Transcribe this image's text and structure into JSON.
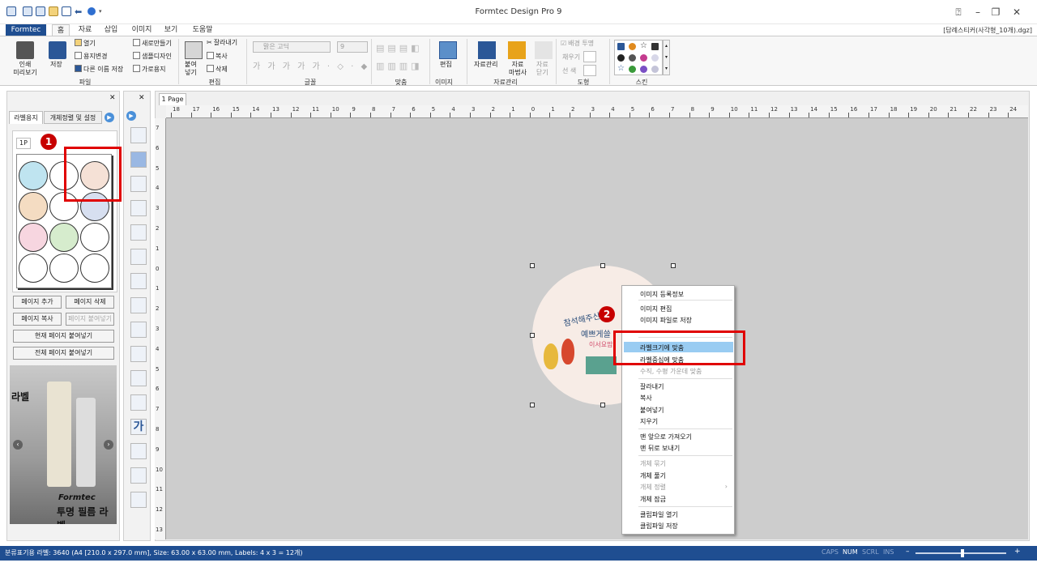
{
  "app": {
    "title": "Formtec Design Pro 9",
    "doc_name": "[답례스티커(사각형_10개).dgz]"
  },
  "menu": {
    "formtec": "Formtec",
    "tabs": [
      "홈",
      "자료",
      "삽입",
      "이미지",
      "보기",
      "도움말"
    ]
  },
  "ribbon": {
    "print_preview": "인쇄\n미리보기",
    "save": "저장",
    "open": "열기",
    "paper_change": "용지변경",
    "save_as": "다른 이름 저장",
    "new": "새로만들기",
    "sample_design": "샘플디자인",
    "landscape": "가로용지",
    "group_file": "파일",
    "paste": "붙여\n넣기",
    "cut": "잘라내기",
    "copy": "복사",
    "delete": "삭제",
    "group_edit": "편집",
    "font_name": "맑은 고딕",
    "font_size": "9",
    "group_font": "글꼴",
    "group_align": "맞춤",
    "edit": "편집",
    "group_image": "이미지",
    "data_manage": "자료관리",
    "data_wizard": "자료\n마법사",
    "data_close": "자료\n닫기",
    "group_data": "자료관리",
    "bg_transparent": "배경 투명",
    "fill": "채우기",
    "line": "선   색",
    "group_shape": "도형",
    "group_skin": "스킨"
  },
  "left_panel": {
    "tab_label_paper": "라벨용지",
    "tab_object": "개체정렬 및 설정",
    "page_tab": "1P",
    "add_page": "페이지 추가",
    "del_page": "페이지 삭제",
    "copy_page": "페이지 복사",
    "paste_page": "페이지 붙여넣기",
    "paste_current": "현재 페이지 붙여넣기",
    "paste_all": "전체 페이지 붙여넣기",
    "ad_brand": "Formtec",
    "ad_text": "투명 필름 라벨",
    "ad_side": "라벨"
  },
  "doc_tab": "1 Page",
  "ruler": {
    "h": [
      "18",
      "17",
      "16",
      "15",
      "14",
      "13",
      "12",
      "11",
      "10",
      "9",
      "8",
      "7",
      "6",
      "5",
      "4",
      "3",
      "2",
      "1",
      "0",
      "1",
      "2",
      "3",
      "4",
      "5",
      "6",
      "7",
      "8",
      "9",
      "10",
      "11",
      "12",
      "13",
      "14",
      "15",
      "16",
      "17",
      "18",
      "19",
      "20",
      "21",
      "22",
      "23",
      "24"
    ],
    "v": [
      "7",
      "6",
      "5",
      "4",
      "3",
      "2",
      "1",
      "0",
      "1",
      "2",
      "3",
      "4",
      "5",
      "6",
      "7",
      "8",
      "9",
      "10",
      "11",
      "12",
      "13"
    ]
  },
  "sticker": {
    "line1": "참석해주신",
    "line2": "예쁘게쓸",
    "line3": "이서요맘"
  },
  "context_menu": [
    {
      "label": "이미지 등록정보",
      "disabled": false
    },
    {
      "label": "이미지 편집",
      "disabled": false
    },
    {
      "label": "이미지 파일로 저장",
      "disabled": false
    },
    {
      "label": "라벨크기에 맞춤",
      "disabled": false
    },
    {
      "label": "라벨중심에 맞춤",
      "disabled": false
    },
    {
      "label": "수직, 수평 가운데 맞춤",
      "disabled": true
    },
    {
      "label": "잘라내기",
      "disabled": false
    },
    {
      "label": "복사",
      "disabled": false
    },
    {
      "label": "붙여넣기",
      "disabled": false
    },
    {
      "label": "지우기",
      "disabled": false
    },
    {
      "label": "맨 앞으로 가져오기",
      "disabled": false
    },
    {
      "label": "맨 뒤로 보내기",
      "disabled": false
    },
    {
      "label": "개체 묶기",
      "disabled": true
    },
    {
      "label": "개체 풀기",
      "disabled": false
    },
    {
      "label": "개체 정렬",
      "disabled": true
    },
    {
      "label": "개체 잠금",
      "disabled": false
    },
    {
      "label": "클립파일 열기",
      "disabled": false
    },
    {
      "label": "클립파일 저장",
      "disabled": false
    }
  ],
  "badges": {
    "one": "1",
    "two": "2"
  },
  "status": {
    "info": "분류표기용 라벨: 3640 (A4 [210.0 x 297.0 mm], Size: 63.00 x 63.00 mm, Labels: 4 x 3 = 12개)",
    "caps": "CAPS",
    "num": "NUM",
    "scrl": "SCRL",
    "ins": "INS"
  },
  "colors": {
    "accent": "#1f4e91",
    "highlight": "#99ccf2",
    "red": "#e00000"
  }
}
